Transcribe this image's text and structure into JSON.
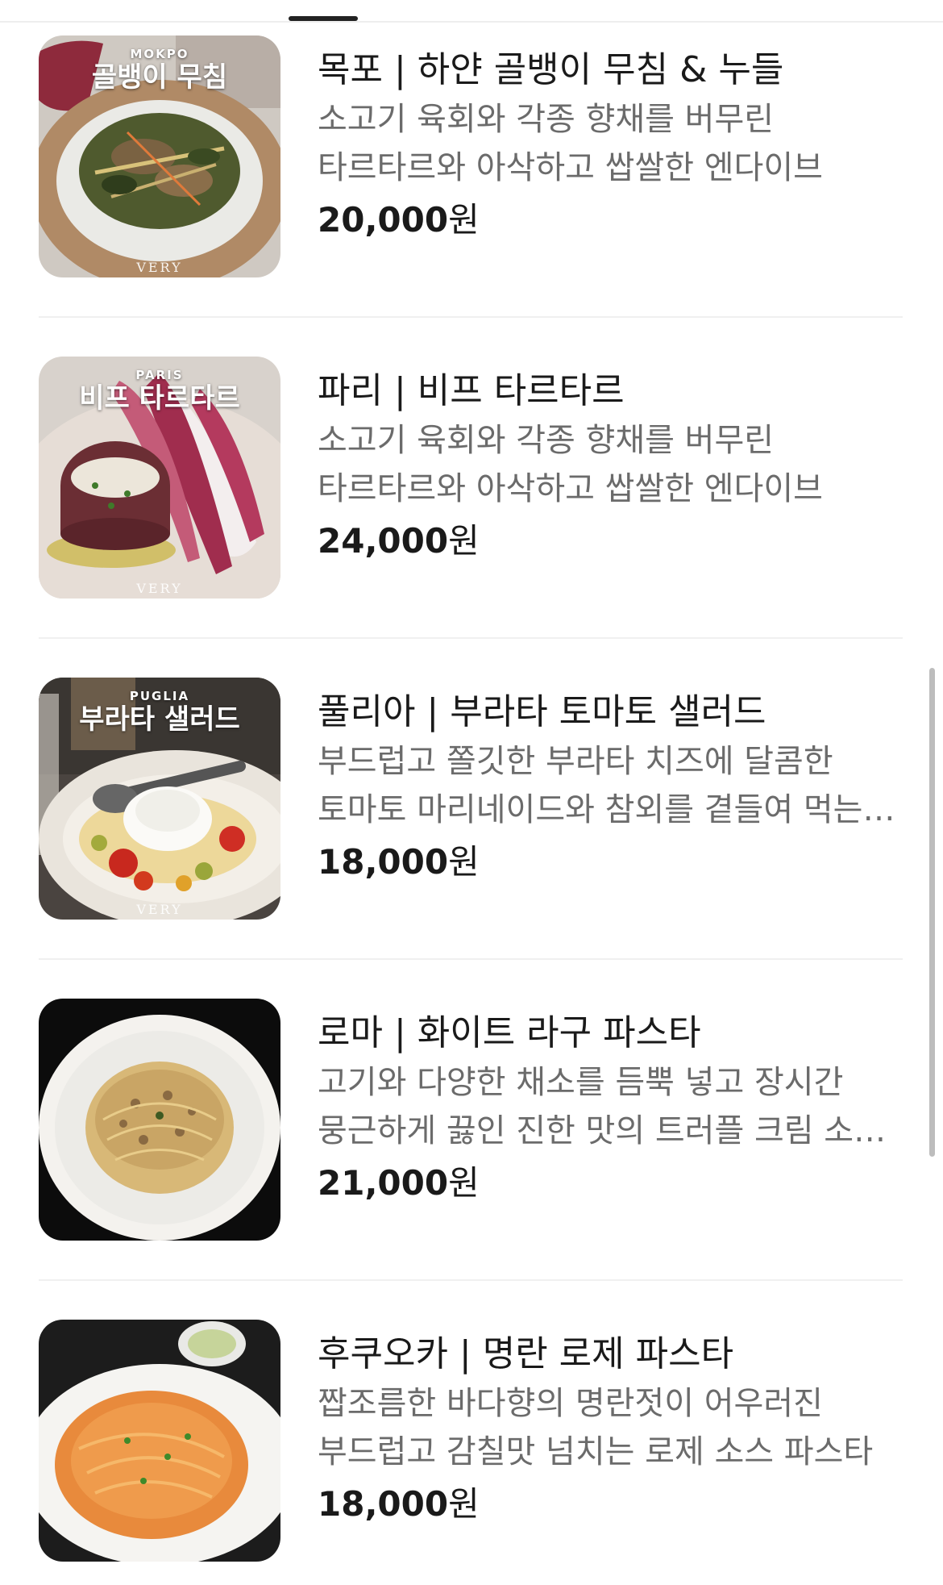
{
  "header": {
    "active_tab_indicator": true
  },
  "menu": {
    "items": [
      {
        "thumb_city": "MOKPO",
        "thumb_dish": "골뱅이 무침",
        "thumb_brand": "VERY",
        "name": "목포 | 하얀 골뱅이 무침 & 누들",
        "description": "소고기 육회와 각종 향채를 버무린 타르타르와 아삭하고 쌉쌀한 엔다이브",
        "price_number": "20,000",
        "price_unit": "원"
      },
      {
        "thumb_city": "PARIS",
        "thumb_dish": "비프 타르타르",
        "thumb_brand": "VERY",
        "name": "파리 | 비프 타르타르",
        "description": "소고기 육회와 각종 향채를 버무린 타르타르와 아삭하고 쌉쌀한 엔다이브",
        "price_number": "24,000",
        "price_unit": "원"
      },
      {
        "thumb_city": "PUGLIA",
        "thumb_dish": "부라타 샐러드",
        "thumb_brand": "VERY",
        "name": "풀리아 | 부라타 토마토 샐러드",
        "description": "부드럽고 쫄깃한 부라타 치즈에 달콤한 토마토 마리네이드와 참외를 곁들여 먹는 …",
        "price_number": "18,000",
        "price_unit": "원"
      },
      {
        "name": "로마 | 화이트 라구 파스타",
        "description": "고기와 다양한 채소를 듬뿍 넣고 장시간 뭉근하게 끓인 진한 맛의 트러플 크림 소스 …",
        "price_number": "21,000",
        "price_unit": "원"
      },
      {
        "name": "후쿠오카 | 명란 로제 파스타",
        "description": "짭조름한 바다향의 명란젓이 어우러진 부드럽고 감칠맛 넘치는 로제 소스 파스타",
        "price_number": "18,000",
        "price_unit": "원"
      }
    ]
  }
}
